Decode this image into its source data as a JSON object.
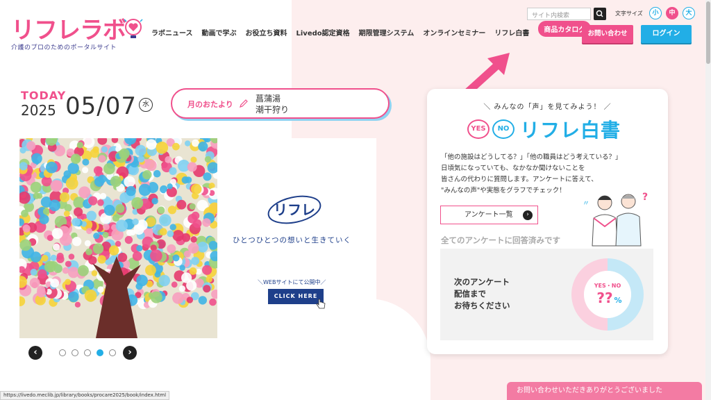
{
  "header": {
    "logo_text": "リフレラボ",
    "logo_subtitle": "介護のプロのためのポータルサイト",
    "nav": [
      {
        "label": "ラボニュース"
      },
      {
        "label": "動画で学ぶ"
      },
      {
        "label": "お役立ち資料"
      },
      {
        "label": "Livedo認定資格"
      },
      {
        "label": "期限管理システム"
      },
      {
        "label": "オンラインセミナー"
      },
      {
        "label": "リフレ白書"
      },
      {
        "label": "商品カタログ"
      }
    ],
    "search_placeholder": "サイト内検索",
    "fontsize_label": "文字サイズ",
    "fontsize_options": [
      "小",
      "中",
      "大"
    ],
    "contact_label": "お問い合わせ",
    "login_label": "ログイン",
    "colors": {
      "accent": "#f0508c",
      "blue": "#22aee6"
    }
  },
  "date": {
    "today_label": "TODAY",
    "year": "2025",
    "month_day": "05/07",
    "weekday": "水"
  },
  "otayori": {
    "label": "月のおたより",
    "lines": [
      "菖蒲湯",
      "潮干狩り"
    ]
  },
  "banner": {
    "brand": "リフレ",
    "tagline": "ひとつひとつの想いと生きていく",
    "web_label": "＼WEBサイトにて公開中／",
    "cta": "CLICK HERE",
    "slides": 5,
    "active_slide": 4
  },
  "hakusho": {
    "subtitle": "＼ みんなの「声」を見てみよう！ ／",
    "yes": "YES",
    "no": "NO",
    "title": "リフレ白書",
    "desc": [
      "「他の施設はどうしてる？」「他の職員はどう考えている？」",
      "日頃気になっていても、なかなか聞けないことを",
      "皆さんの代わりに質問します。アンケートに答えて、",
      "\"みんなの声\"や実態をグラフでチェック！"
    ],
    "survey_list": "アンケート一覧",
    "all_answered": "全てのアンケートに回答済みです",
    "next_lines": [
      "次のアンケート",
      "配信まで",
      "お待ちください"
    ],
    "donut_label": "YES・NO",
    "donut_value": "??",
    "donut_unit": "%"
  },
  "toast": "お問い合わせいただきありがとうございました",
  "status_url": "https://livedo.meclib.jp/library/books/procare2025/book/index.html"
}
